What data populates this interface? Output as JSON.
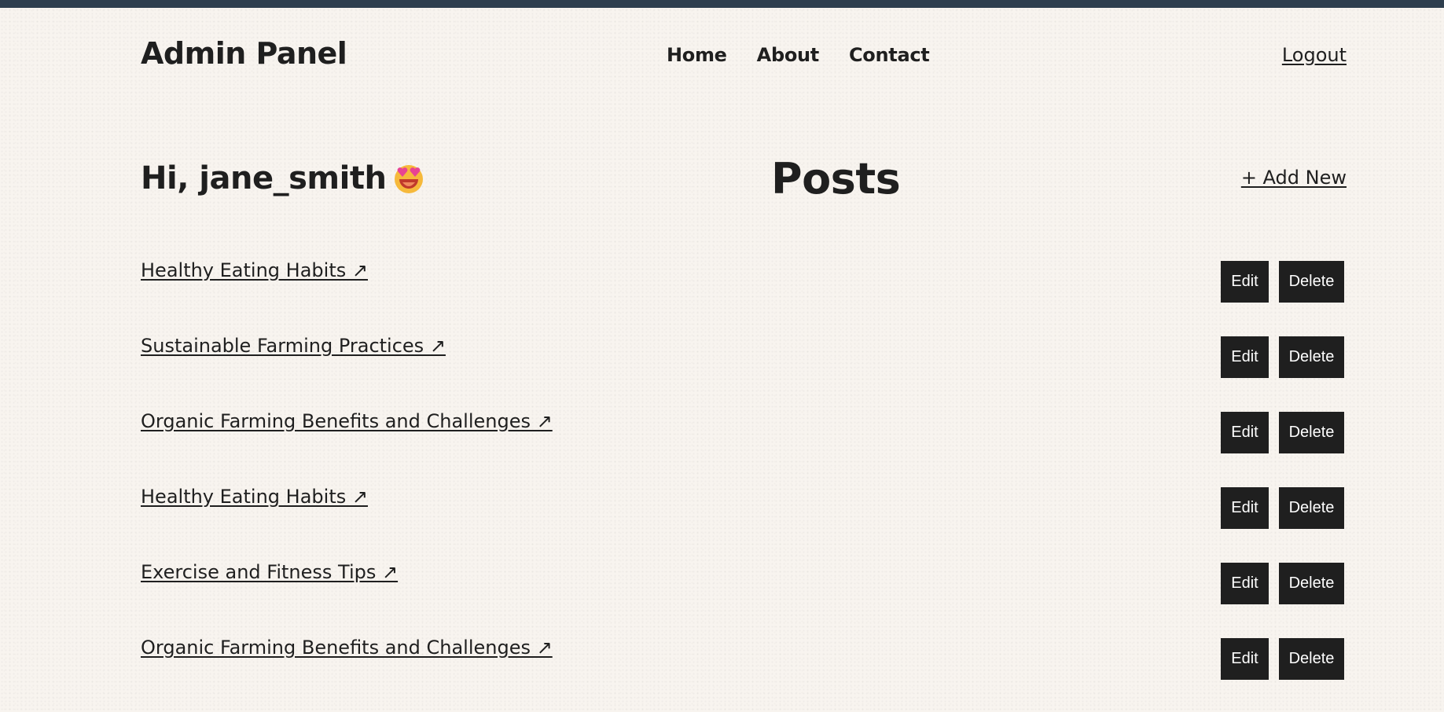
{
  "header": {
    "brand": "Admin Panel",
    "nav": [
      {
        "label": "Home"
      },
      {
        "label": "About"
      },
      {
        "label": "Contact"
      }
    ],
    "logout_label": "Logout"
  },
  "main": {
    "greeting": "Hi, jane_smith",
    "greeting_emoji": "heart-eyes-emoji",
    "posts_title": "Posts",
    "add_new_label": "+ Add New",
    "edit_label": "Edit",
    "delete_label": "Delete",
    "posts": [
      {
        "title": "Healthy Eating Habits ↗"
      },
      {
        "title": "Sustainable Farming Practices ↗"
      },
      {
        "title": "Organic Farming Benefits and Challenges ↗"
      },
      {
        "title": "Healthy Eating Habits ↗"
      },
      {
        "title": "Exercise and Fitness Tips ↗"
      },
      {
        "title": "Organic Farming Benefits and Challenges ↗"
      }
    ]
  },
  "colors": {
    "background": "#f8f4ef",
    "topbar": "#2e3e4e",
    "text": "#1f1f1f",
    "button": "#1f1f1f"
  }
}
